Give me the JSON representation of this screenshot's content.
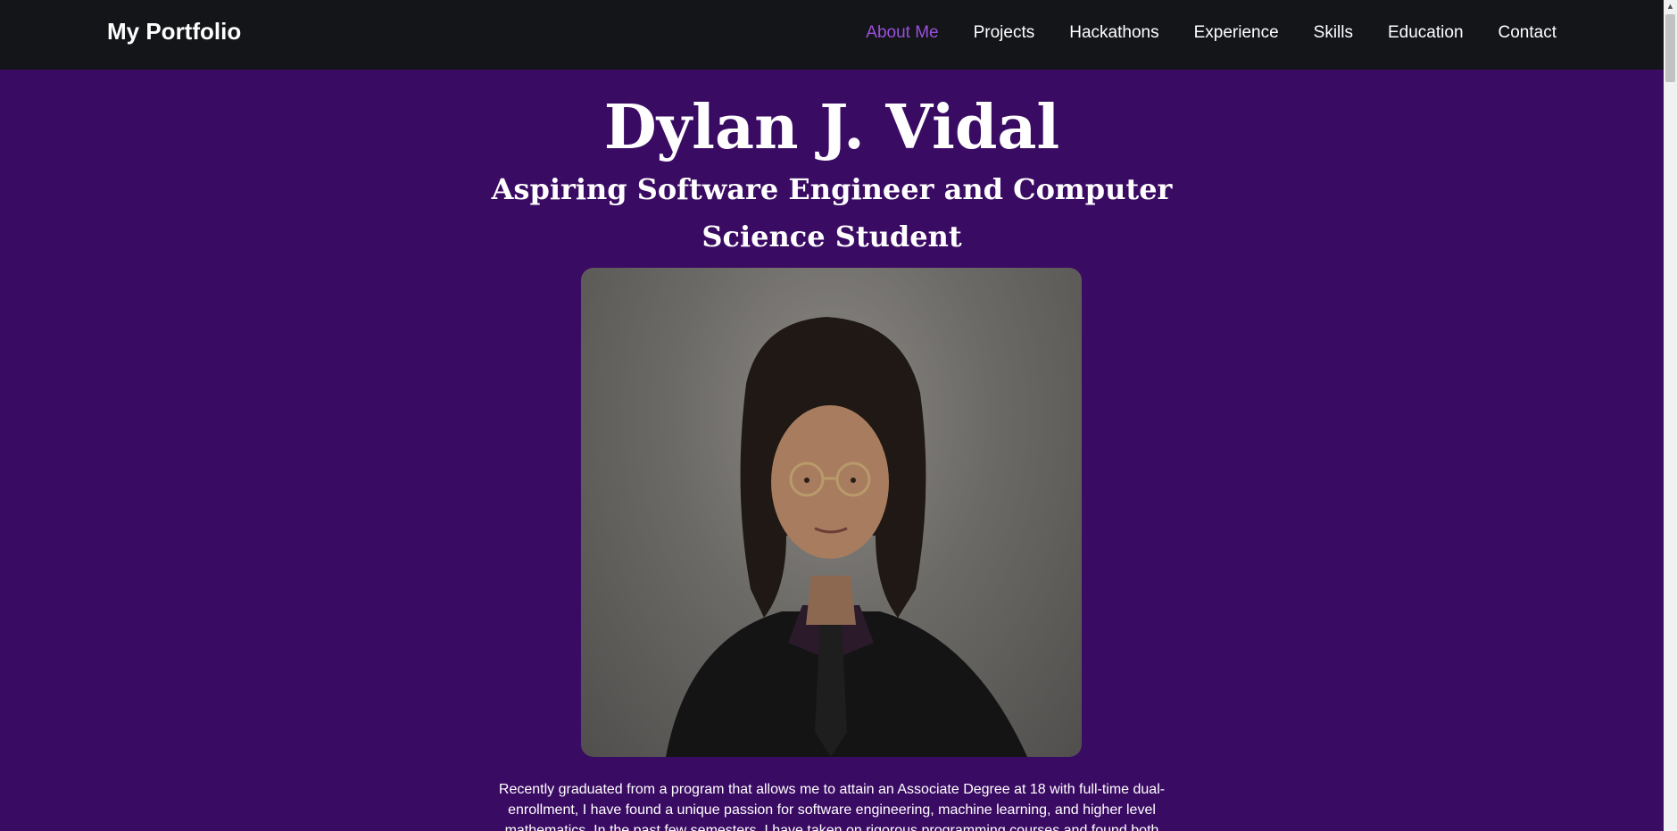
{
  "navbar": {
    "brand": "My Portfolio",
    "links": [
      {
        "label": "About Me",
        "active": true
      },
      {
        "label": "Projects",
        "active": false
      },
      {
        "label": "Hackathons",
        "active": false
      },
      {
        "label": "Experience",
        "active": false
      },
      {
        "label": "Skills",
        "active": false
      },
      {
        "label": "Education",
        "active": false
      },
      {
        "label": "Contact",
        "active": false
      }
    ]
  },
  "hero": {
    "name": "Dylan J. Vidal",
    "subtitle": "Aspiring Software Engineer and Computer Science Student",
    "bio": "Recently graduated from a program that allows me to attain an Associate Degree at 18 with full-time dual-enrollment, I have found a unique passion for software engineering, machine learning, and higher level mathematics. In the past few semesters, I have taken on rigorous programming courses and found both"
  },
  "colors": {
    "navbar_bg": "#131518",
    "page_bg": "#3a0b63",
    "active_link": "#9a4fde",
    "text": "#ffffff"
  },
  "scrollbar": {
    "up_icon": "scroll-up-arrow-icon"
  }
}
